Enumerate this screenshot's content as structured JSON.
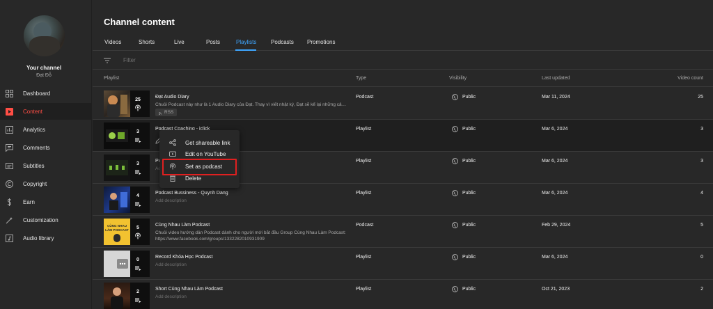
{
  "sidebar": {
    "channel_title": "Your channel",
    "channel_handle": "Đạt Đỗ",
    "items": [
      {
        "label": "Dashboard",
        "icon": "dashboard-icon"
      },
      {
        "label": "Content",
        "icon": "content-icon"
      },
      {
        "label": "Analytics",
        "icon": "analytics-icon"
      },
      {
        "label": "Comments",
        "icon": "comments-icon"
      },
      {
        "label": "Subtitles",
        "icon": "subtitles-icon"
      },
      {
        "label": "Copyright",
        "icon": "copyright-icon"
      },
      {
        "label": "Earn",
        "icon": "earn-icon"
      },
      {
        "label": "Customization",
        "icon": "customization-icon"
      },
      {
        "label": "Audio library",
        "icon": "audio-library-icon"
      }
    ],
    "active_index": 1
  },
  "main": {
    "title": "Channel content",
    "tabs": [
      "Videos",
      "Shorts",
      "Live",
      "Posts",
      "Playlists",
      "Podcasts",
      "Promotions"
    ],
    "active_tab": "Playlists",
    "filter_placeholder": "Filter",
    "columns": {
      "playlist": "Playlist",
      "type": "Type",
      "visibility": "Visibility",
      "last_updated": "Last updated",
      "video_count": "Video count"
    },
    "rows": [
      {
        "count": "25",
        "title": "Đạt Audio Diary",
        "desc": "Chuỗi Podcast này như là 1 Audio Diary của Đạt. Thay vì viết nhật ký, Đạt sẽ kể lại những câu...",
        "rss": "RSS",
        "type": "Podcast",
        "visibility": "Public",
        "updated": "Mar 11, 2024",
        "video_count": "25"
      },
      {
        "count": "3",
        "title": "Podcast Coaching - iclick",
        "desc": "",
        "type": "Playlist",
        "visibility": "Public",
        "updated": "Mar 6, 2024",
        "video_count": "3"
      },
      {
        "count": "3",
        "title": "Po",
        "desc": "Ad",
        "type": "Playlist",
        "visibility": "Public",
        "updated": "Mar 6, 2024",
        "video_count": "3"
      },
      {
        "count": "4",
        "title": "Podcast Bussiness - Quynh Dang",
        "desc": "Add description",
        "type": "Playlist",
        "visibility": "Public",
        "updated": "Mar 6, 2024",
        "video_count": "4"
      },
      {
        "count": "5",
        "title": "Cùng Nhau Làm Podcast",
        "desc": "Chuỗi video hướng dẫn Podcast dành cho người mới bắt đầu Group Cùng Nhau Làm Podcast:",
        "desc2": "https://www.facebook.com/groups/1332282010931909",
        "type": "Podcast",
        "visibility": "Public",
        "updated": "Feb 29, 2024",
        "video_count": "5"
      },
      {
        "count": "0",
        "title": "Record Khóa Học Podcast",
        "desc": "Add description",
        "type": "Playlist",
        "visibility": "Public",
        "updated": "Mar 6, 2024",
        "video_count": "0"
      },
      {
        "count": "2",
        "title": "Short Cùng Nhau Làm Podcast",
        "desc": "Add description",
        "type": "Playlist",
        "visibility": "Public",
        "updated": "Oct 21, 2023",
        "video_count": "2"
      }
    ]
  },
  "menu": {
    "items": [
      "Get shareable link",
      "Edit on YouTube",
      "Set as podcast",
      "Delete"
    ],
    "highlighted": "Set as podcast"
  },
  "thumbnail_text": {
    "cung_nhau": [
      "CÙNG NHAU",
      "LÀM PODCAST"
    ]
  },
  "colors": {
    "accent_blue": "#3ea6ff",
    "active_red": "#ff4e45",
    "highlight_box": "#e02020",
    "background": "#282828"
  }
}
